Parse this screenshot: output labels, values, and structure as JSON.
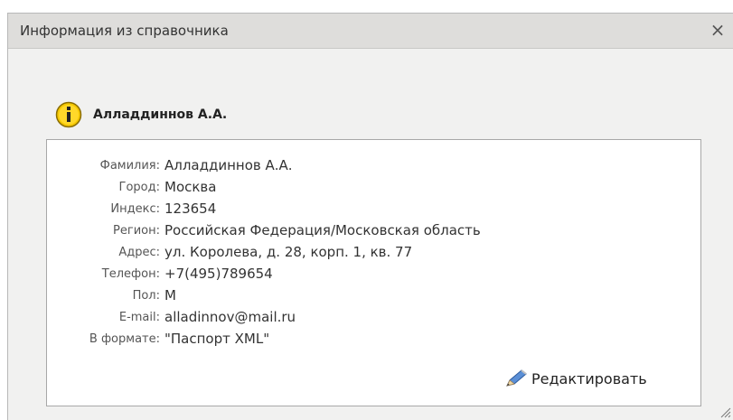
{
  "window": {
    "title": "Информация из справочника",
    "close_label": "×"
  },
  "person": {
    "name": "Алладдиннов А.А."
  },
  "fields": [
    {
      "label": "Фамилия:",
      "value": "Алладдиннов А.А."
    },
    {
      "label": "Город:",
      "value": "Москва"
    },
    {
      "label": "Индекс:",
      "value": "123654"
    },
    {
      "label": "Регион:",
      "value": "Российская Федерация/Московская область"
    },
    {
      "label": "Адрес:",
      "value": "ул. Королева, д. 28, корп. 1, кв. 77"
    },
    {
      "label": "Телефон:",
      "value": "+7(495)789654"
    },
    {
      "label": "Пол:",
      "value": "М"
    },
    {
      "label": "E-mail:",
      "value": "alladinnov@mail.ru"
    },
    {
      "label": "В формате:",
      "value": "\"Паспорт XML\""
    }
  ],
  "actions": {
    "edit_label": "Редактировать"
  },
  "icons": {
    "info": "info-icon",
    "edit": "pencil-icon",
    "close": "close-icon",
    "resize": "resize-grip-icon"
  },
  "colors": {
    "titlebar": "#dedddb",
    "dialog_bg": "#f1f1f0",
    "info_icon": "#f3c300"
  }
}
